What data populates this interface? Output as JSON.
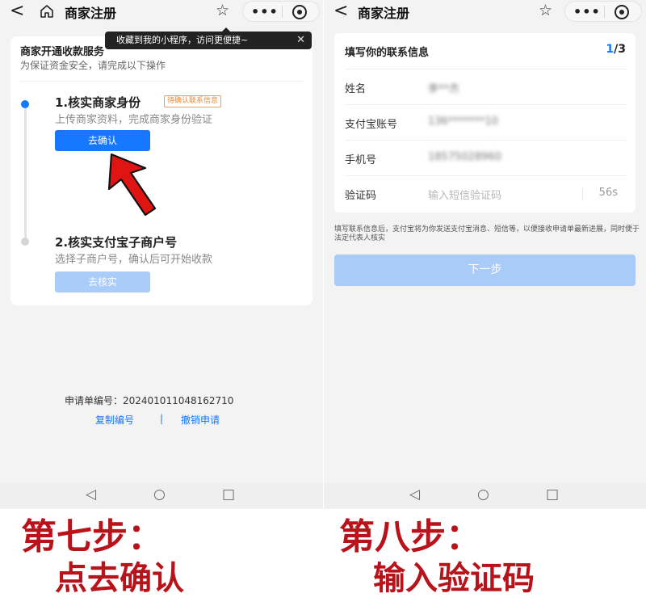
{
  "left": {
    "nav": {
      "back": "<",
      "title": "商家注册"
    },
    "tooltip": {
      "text": "收藏到我的小程序，访问更便捷~",
      "close": "✕"
    },
    "card": {
      "title": "商家开通收款服务",
      "subtitle": "为保证资金安全，请完成以下操作",
      "step1": {
        "title": "1.核实商家身份",
        "badge": "待确认联系信息",
        "desc": "上传商家资料，完成商家身份验证",
        "button": "去确认"
      },
      "step2": {
        "title": "2.核实支付宝子商户号",
        "desc": "选择子商户号，确认后可开始收款",
        "button": "去核实"
      }
    },
    "application_no": "申请单编号：20240101104816271​0",
    "links": {
      "copy": "复制编号",
      "separator": "|",
      "cancel": "撤销申请"
    }
  },
  "right": {
    "nav": {
      "back": "<",
      "title": "商家注册"
    },
    "form": {
      "title": "填写你的联系信息",
      "step_current": "1",
      "step_total": "/3",
      "fields": [
        {
          "label": "姓名",
          "value": "李**杰"
        },
        {
          "label": "支付宝账号",
          "value": "136*******10"
        },
        {
          "label": "手机号",
          "value": "18575028960"
        },
        {
          "label": "验证码",
          "placeholder": "输入短信验证码",
          "countdown": "56s"
        }
      ]
    },
    "notice": "填写联系信息后，支付宝将为你发送支付宝消息、短信等，以便接收申请单最新进展，同时便于法定代表人核实",
    "next_button": "下一步"
  },
  "system_nav": {
    "back": "◁",
    "home": "○",
    "recent": "□"
  },
  "captions": {
    "left_line1": "第七步：",
    "left_line2": "点去确认",
    "right_line1": "第八步：",
    "right_line2": "输入验证码"
  },
  "colors": {
    "accent": "#1677ff",
    "caption": "#b8131b",
    "arrow": "#e11414",
    "badge": "#ef8a2c"
  }
}
